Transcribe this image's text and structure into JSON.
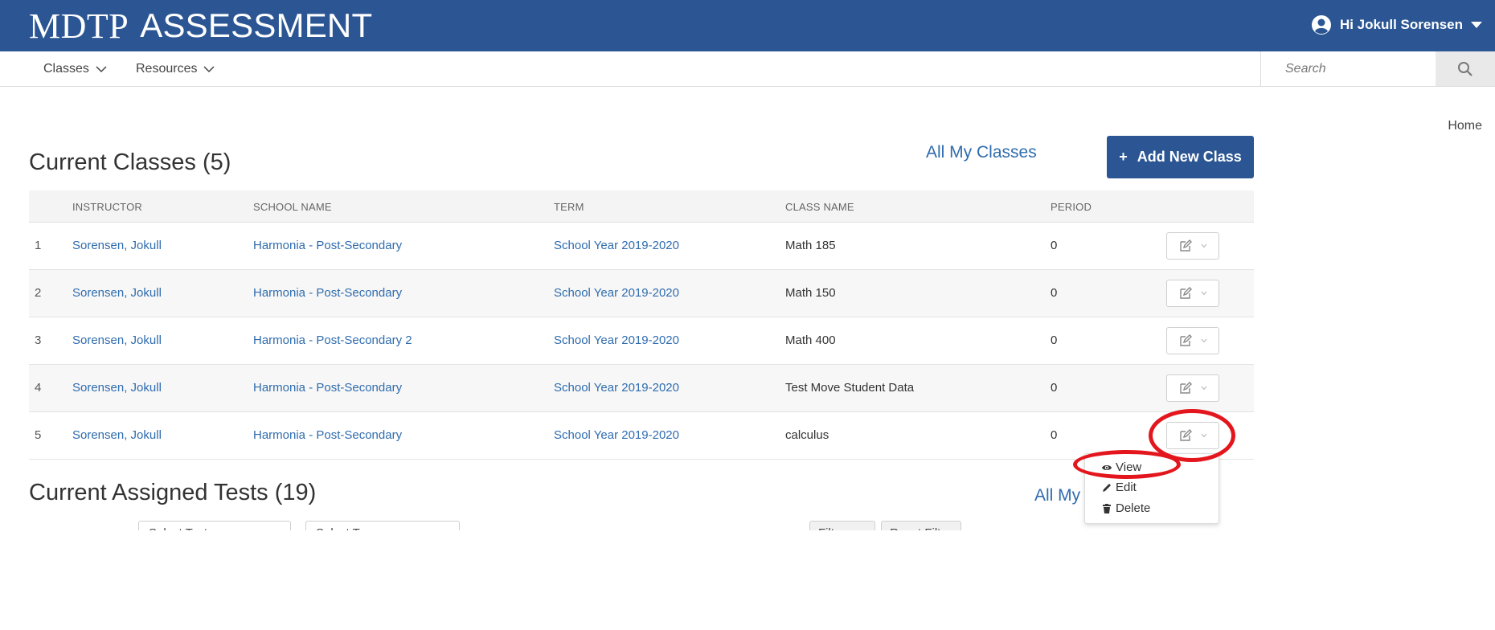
{
  "header": {
    "brand_part1": "MDTP",
    "brand_part2": "ASSESSMENT",
    "user_greeting": "Hi Jokull Sorensen",
    "bg_color": "#2b5693"
  },
  "nav": {
    "items": [
      {
        "label": "Classes"
      },
      {
        "label": "Resources"
      }
    ],
    "search_placeholder": "Search"
  },
  "breadcrumb": "Home",
  "classes_section": {
    "title": "Current Classes (5)",
    "all_link": "All My Classes",
    "add_button_plus": "+",
    "add_button": "Add New Class",
    "columns": [
      "INSTRUCTOR",
      "SCHOOL NAME",
      "TERM",
      "CLASS NAME",
      "PERIOD"
    ],
    "rows": [
      {
        "num": "1",
        "instructor": "Sorensen, Jokull",
        "school": "Harmonia - Post-Secondary",
        "term": "School Year 2019-2020",
        "class_name": "Math 185",
        "period": "0"
      },
      {
        "num": "2",
        "instructor": "Sorensen, Jokull",
        "school": "Harmonia - Post-Secondary",
        "term": "School Year 2019-2020",
        "class_name": "Math 150",
        "period": "0"
      },
      {
        "num": "3",
        "instructor": "Sorensen, Jokull",
        "school": "Harmonia - Post-Secondary 2",
        "term": "School Year 2019-2020",
        "class_name": "Math 400",
        "period": "0"
      },
      {
        "num": "4",
        "instructor": "Sorensen, Jokull",
        "school": "Harmonia - Post-Secondary",
        "term": "School Year 2019-2020",
        "class_name": "Test Move Student Data",
        "period": "0"
      },
      {
        "num": "5",
        "instructor": "Sorensen, Jokull",
        "school": "Harmonia - Post-Secondary",
        "term": "School Year 2019-2020",
        "class_name": "calculus",
        "period": "0"
      }
    ]
  },
  "action_menu": {
    "items": [
      {
        "label": "View",
        "icon": "eye-icon"
      },
      {
        "label": "Edit",
        "icon": "pencil-icon"
      },
      {
        "label": "Delete",
        "icon": "trash-icon"
      }
    ]
  },
  "tests_section": {
    "title": "Current Assigned Tests (19)",
    "all_link": "All My",
    "filter_1": "Select Test",
    "filter_2": "Select Type",
    "filter_button": "Filter",
    "reset_button": "Reset Filters"
  },
  "colors": {
    "link": "#2f6cae",
    "annotation": "#e4161d"
  }
}
